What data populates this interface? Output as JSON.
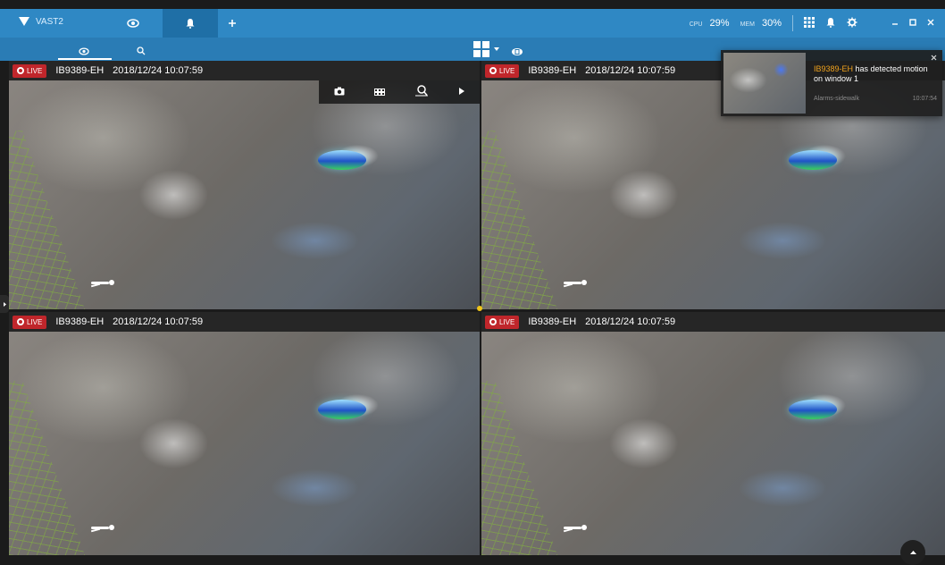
{
  "app": {
    "title": "VAST2"
  },
  "system": {
    "cpu_label": "CPU",
    "cpu_value": "29%",
    "mem_label": "MEM",
    "mem_value": "30%"
  },
  "tiles": [
    {
      "live_label": "LIVE",
      "camera": "IB9389-EH",
      "timestamp": "2018/12/24 10:07:59"
    },
    {
      "live_label": "LIVE",
      "camera": "IB9389-EH",
      "timestamp": "2018/12/24 10:07:59"
    },
    {
      "live_label": "LIVE",
      "camera": "IB9389-EH",
      "timestamp": "2018/12/24 10:07:59"
    },
    {
      "live_label": "LIVE",
      "camera": "IB9389-EH",
      "timestamp": "2018/12/24 10:07:59"
    }
  ],
  "notification": {
    "camera": "IB9389-EH",
    "message": " has detected motion on window 1",
    "source": "Alarms-sidewalk",
    "time": "10:07:54"
  },
  "colors": {
    "accent": "#2f88c4",
    "accent_dark": "#1f6fa6",
    "live_red": "#c0262b",
    "selection": "#f0c419",
    "highlight": "#f0a21c"
  },
  "icons": {
    "titlebar": [
      "vast-logo-icon",
      "eye-icon",
      "bell-icon",
      "plus-icon",
      "grid-icon",
      "bell-icon",
      "gear-icon",
      "minimize-icon",
      "maximize-icon",
      "close-icon"
    ],
    "toolbar": [
      "eye-icon",
      "search-icon",
      "layout-icon",
      "chevron-down-icon",
      "fisheye-icon"
    ],
    "tile_overlay": [
      "snapshot-icon",
      "film-icon",
      "fisheye-search-icon",
      "play-icon"
    ]
  }
}
